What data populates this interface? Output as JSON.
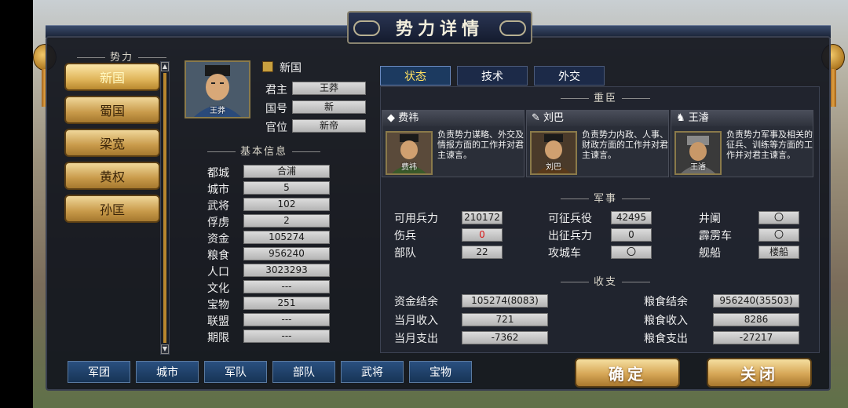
{
  "title": "势力详情",
  "forces": {
    "header": "势力",
    "items": [
      "新国",
      "蜀国",
      "梁宽",
      "黄权",
      "孙匡"
    ],
    "active_index": 0
  },
  "leader": {
    "portrait_name": "王莽",
    "faction_name": "新国",
    "rows": [
      {
        "label": "君主",
        "value": "王莽"
      },
      {
        "label": "国号",
        "value": "新"
      },
      {
        "label": "官位",
        "value": "新帝"
      }
    ]
  },
  "basic_info": {
    "header": "基本信息",
    "rows": [
      {
        "label": "都城",
        "value": "合浦"
      },
      {
        "label": "城市",
        "value": "5"
      },
      {
        "label": "武将",
        "value": "102"
      },
      {
        "label": "俘虏",
        "value": "2"
      },
      {
        "label": "资金",
        "value": "105274"
      },
      {
        "label": "粮食",
        "value": "956240"
      },
      {
        "label": "人口",
        "value": "3023293"
      },
      {
        "label": "文化",
        "value": "---"
      },
      {
        "label": "宝物",
        "value": "251"
      },
      {
        "label": "联盟",
        "value": "---"
      },
      {
        "label": "期限",
        "value": "---"
      }
    ]
  },
  "tabs": [
    "状态",
    "技术",
    "外交"
  ],
  "ministers": {
    "header": "重臣",
    "items": [
      {
        "name": "费祎",
        "portrait_name": "费祎",
        "desc": "负责势力谋略、外交及情报方面的工作并对君主谏言。"
      },
      {
        "name": "刘巴",
        "portrait_name": "刘巴",
        "desc": "负责势力内政、人事、财政方面的工作并对君主谏言。"
      },
      {
        "name": "王濬",
        "portrait_name": "王濬",
        "desc": "负责势力军事及相关的征兵、训练等方面的工作并对君主谏言。"
      }
    ]
  },
  "military": {
    "header": "军事",
    "col1": [
      {
        "label": "可用兵力",
        "value": "210172"
      },
      {
        "label": "伤兵",
        "value": "0"
      },
      {
        "label": "部队",
        "value": "22"
      }
    ],
    "col2": [
      {
        "label": "可征兵役",
        "value": "42495"
      },
      {
        "label": "出征兵力",
        "value": "0"
      },
      {
        "label": "攻城车",
        "value": "〇"
      }
    ],
    "col3": [
      {
        "label": "井阑",
        "value": "〇"
      },
      {
        "label": "霹雳车",
        "value": "〇"
      },
      {
        "label": "舰船",
        "value": "楼船"
      }
    ]
  },
  "finance": {
    "header": "收支",
    "col1": [
      {
        "label": "资金结余",
        "value": "105274(8083)"
      },
      {
        "label": "当月收入",
        "value": "721"
      },
      {
        "label": "当月支出",
        "value": "-7362"
      }
    ],
    "col2": [
      {
        "label": "粮食结余",
        "value": "956240(35503)"
      },
      {
        "label": "粮食收入",
        "value": "8286"
      },
      {
        "label": "粮食支出",
        "value": "-27217"
      }
    ]
  },
  "bottom_tabs": [
    "军团",
    "城市",
    "军队",
    "部队",
    "武将",
    "宝物"
  ],
  "buttons": {
    "confirm": "确定",
    "close": "关闭"
  }
}
